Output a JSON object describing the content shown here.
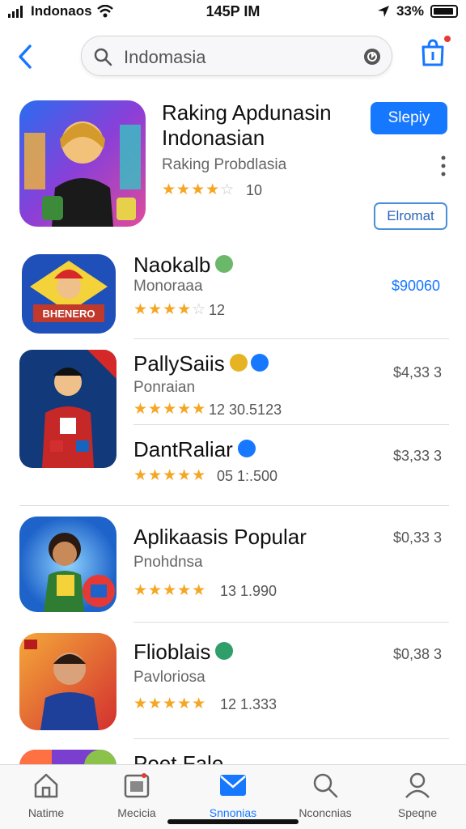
{
  "status_bar": {
    "carrier": "Indonaos",
    "time": "145P IM",
    "battery": "33%"
  },
  "search": {
    "text": "Indomasia"
  },
  "featured": {
    "title_line1": "Raking Apdunasin",
    "title_line2": "Indonasian",
    "subtitle": "Raking Probdlasia",
    "stars": 4,
    "rating": "10",
    "primary_button": "Slepiy",
    "secondary_button": "Elromat"
  },
  "apps": [
    {
      "title": "Naokalb",
      "subtitle": "Monoraaa",
      "stars": 4,
      "meta": "12",
      "price": "$90060",
      "price_color": "#1677ff"
    },
    {
      "title": "PallySaiis",
      "subtitle": "Ponraian",
      "stars": 5,
      "meta": "12  30.5123",
      "price": "$4,33  3"
    },
    {
      "title": "DantRaliar",
      "subtitle": "",
      "stars": 5,
      "meta": "05  1:.500",
      "price": "$3,33  3"
    },
    {
      "title": "Aplikaasis Popular",
      "subtitle": "Pnohdnsa",
      "stars": 5,
      "meta": "13  1.990",
      "price": "$0,33  3"
    },
    {
      "title": "Flioblais",
      "subtitle": "Pavloriosa",
      "stars": 5,
      "meta": "12  1.333",
      "price": "$0,38  3"
    },
    {
      "title": "Poet Fale"
    }
  ],
  "tabs": [
    {
      "label": "Natime",
      "icon": "home-icon"
    },
    {
      "label": "Mecicia",
      "icon": "media-icon"
    },
    {
      "label": "Snnonias",
      "icon": "mail-icon",
      "active": true
    },
    {
      "label": "Nconcnias",
      "icon": "search-icon"
    },
    {
      "label": "Speqne",
      "icon": "person-icon"
    }
  ],
  "colors": {
    "accent": "#1677ff",
    "star": "#f5a623"
  }
}
